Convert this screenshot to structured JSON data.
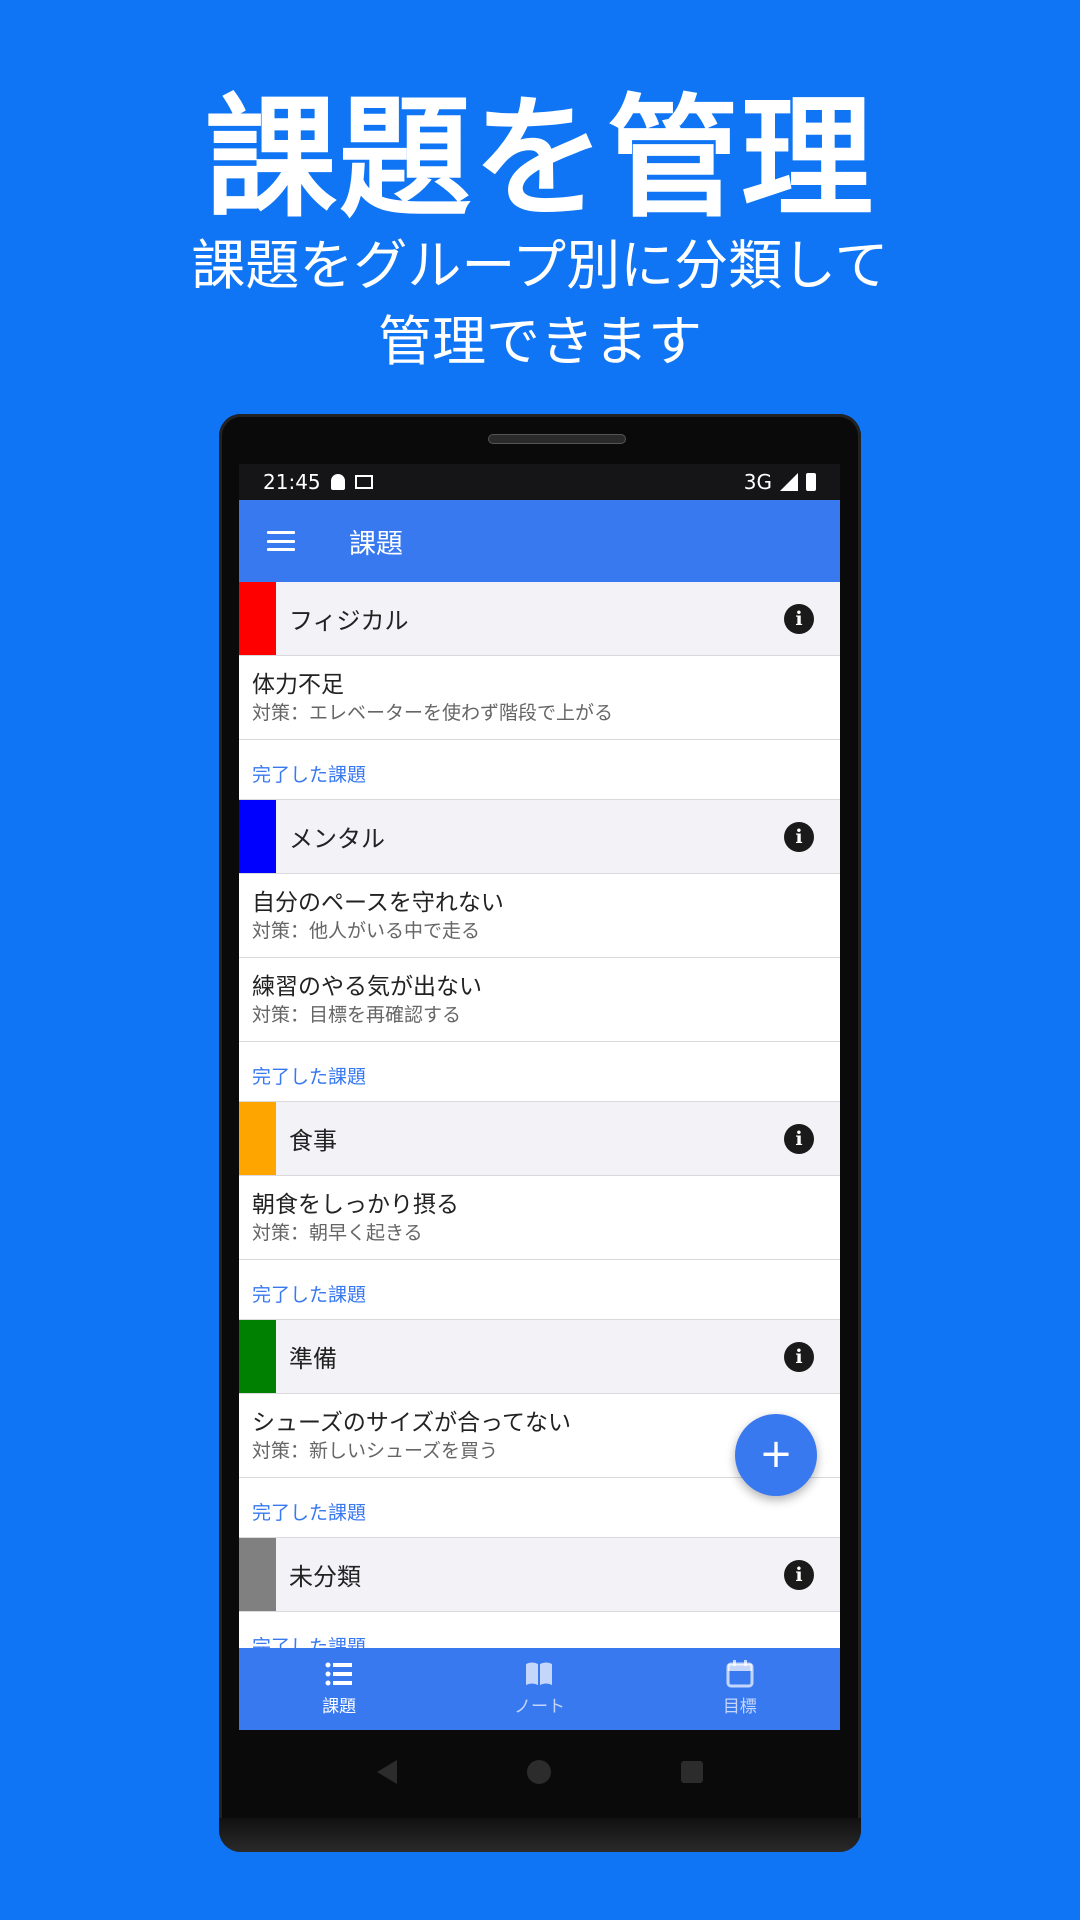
{
  "promo": {
    "title": "課題を管理",
    "subtitle_line1": "課題をグループ別に分類して",
    "subtitle_line2": "管理できます"
  },
  "status_bar": {
    "time": "21:45",
    "network": "3G"
  },
  "app_bar": {
    "title": "課題"
  },
  "groups": [
    {
      "name": "フィジカル",
      "color": "#ff0000",
      "tasks": [
        {
          "title": "体力不足",
          "measure": "対策：エレベーターを使わず階段で上がる"
        }
      ],
      "done_label": "完了した課題"
    },
    {
      "name": "メンタル",
      "color": "#0000ff",
      "tasks": [
        {
          "title": "自分のペースを守れない",
          "measure": "対策：他人がいる中で走る"
        },
        {
          "title": "練習のやる気が出ない",
          "measure": "対策：目標を再確認する"
        }
      ],
      "done_label": "完了した課題"
    },
    {
      "name": "食事",
      "color": "#ffa500",
      "tasks": [
        {
          "title": "朝食をしっかり摂る",
          "measure": "対策：朝早く起きる"
        }
      ],
      "done_label": "完了した課題"
    },
    {
      "name": "準備",
      "color": "#008000",
      "tasks": [
        {
          "title": "シューズのサイズが合ってない",
          "measure": "対策：新しいシューズを買う"
        }
      ],
      "done_label": "完了した課題"
    },
    {
      "name": "未分類",
      "color": "#808080",
      "tasks": [],
      "done_label": "完了した課題"
    }
  ],
  "fab": {
    "label": "+"
  },
  "bottom_nav": [
    {
      "label": "課題",
      "icon": "list-icon",
      "active": true
    },
    {
      "label": "ノート",
      "icon": "book-icon",
      "active": false
    },
    {
      "label": "目標",
      "icon": "calendar-icon",
      "active": false
    }
  ],
  "colors": {
    "background": "#0f75f4",
    "accent": "#3979f0"
  }
}
